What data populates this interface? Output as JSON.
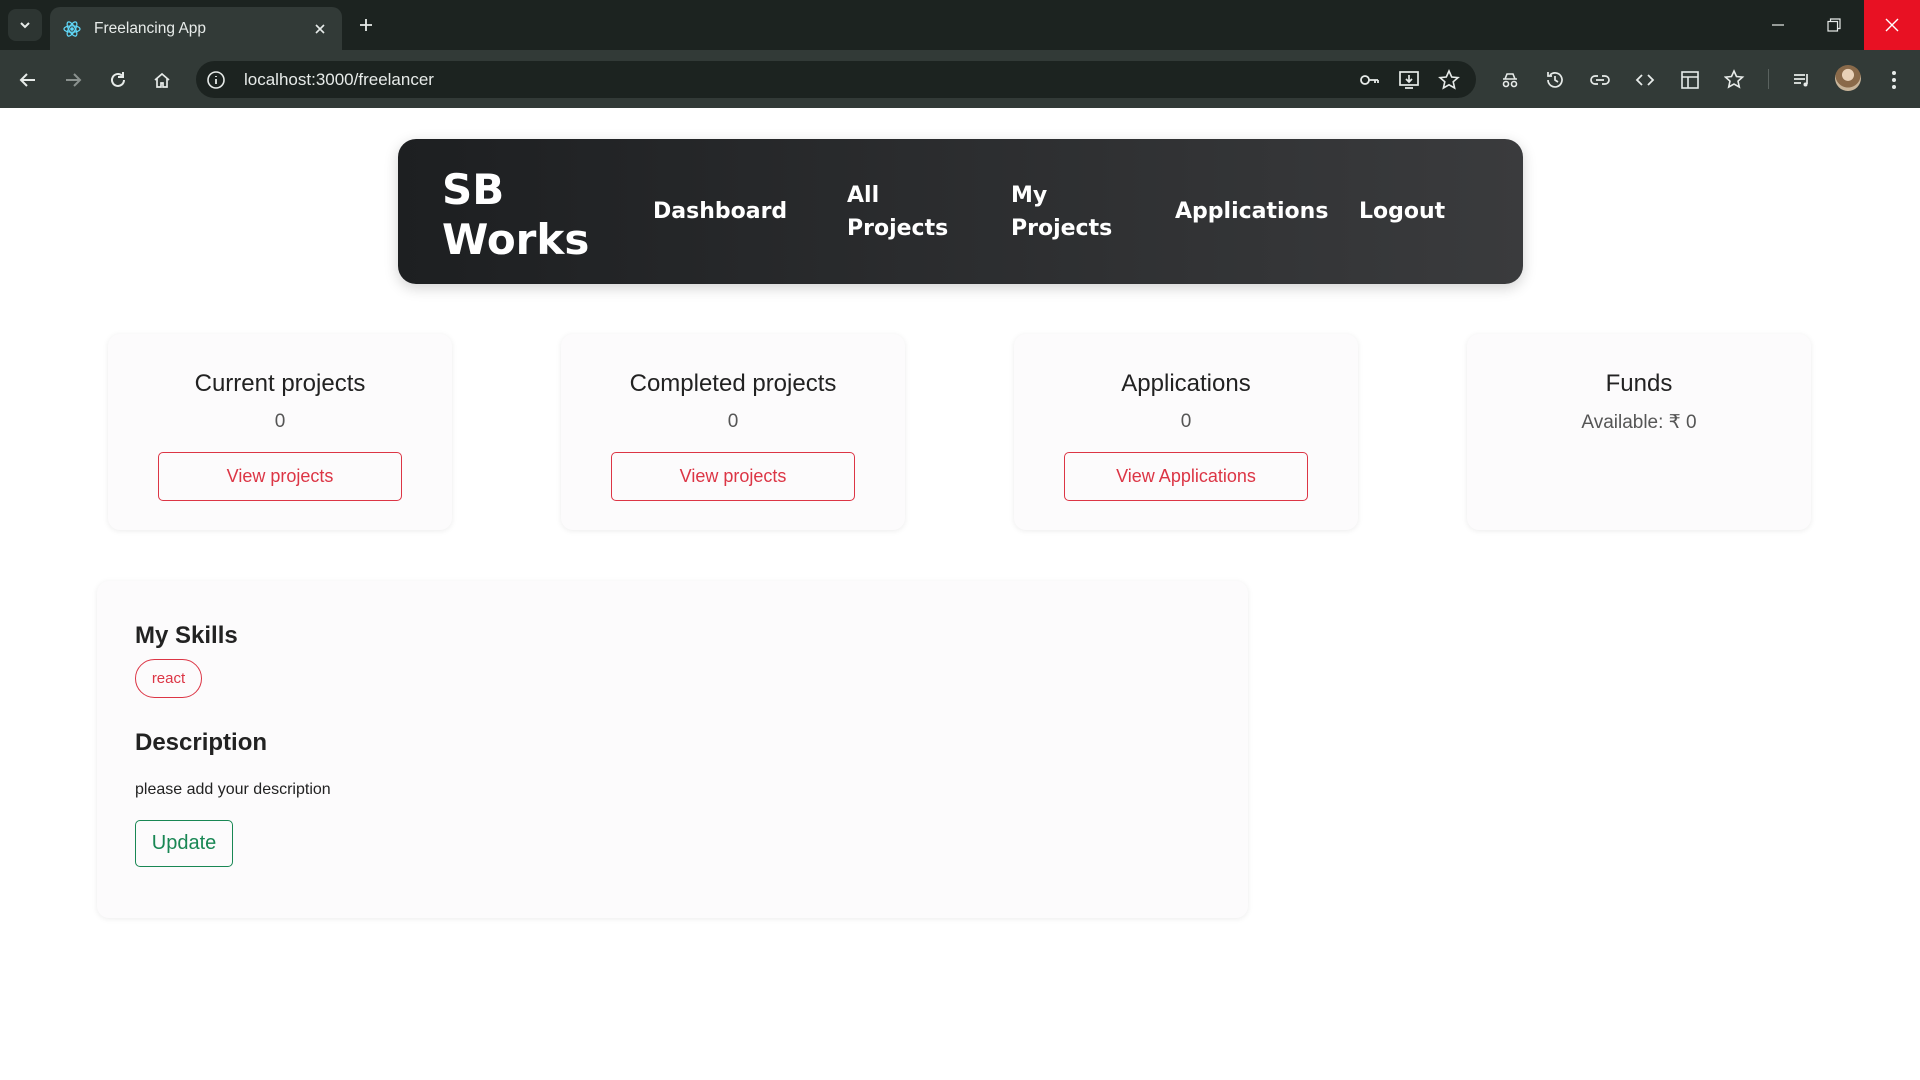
{
  "browser": {
    "tab_title": "Freelancing App",
    "url": "localhost:3000/freelancer"
  },
  "navbar": {
    "brand": "SB Works",
    "links": [
      "Dashboard",
      "All Projects",
      "My Projects",
      "Applications",
      "Logout"
    ]
  },
  "cards": [
    {
      "title": "Current projects",
      "count": "0",
      "button": "View projects"
    },
    {
      "title": "Completed projects",
      "count": "0",
      "button": "View projects"
    },
    {
      "title": "Applications",
      "count": "0",
      "button": "View Applications"
    },
    {
      "title": "Funds",
      "count": "Available: ₹ 0"
    }
  ],
  "profile": {
    "skills_heading": "My Skills",
    "skills": [
      "react"
    ],
    "description_heading": "Description",
    "description": "please add your description",
    "update_button": "Update"
  },
  "colors": {
    "accent_red": "#dc3545",
    "accent_green": "#198754",
    "navbar_dark": "#1d1f21",
    "browser_frame": "#1c2320"
  }
}
